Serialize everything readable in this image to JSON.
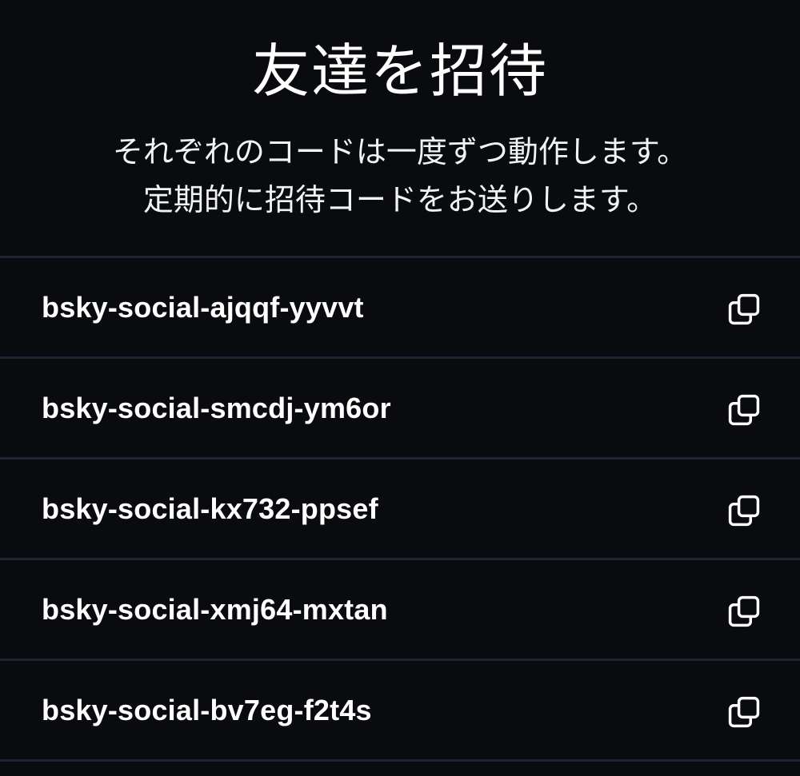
{
  "header": {
    "title": "友達を招待",
    "description_line1": "それぞれのコードは一度ずつ動作します。",
    "description_line2": "定期的に招待コードをお送りします。"
  },
  "codes": [
    {
      "code": "bsky-social-ajqqf-yyvvt",
      "icon": "copy-icon"
    },
    {
      "code": "bsky-social-smcdj-ym6or",
      "icon": "copy-icon"
    },
    {
      "code": "bsky-social-kx732-ppsef",
      "icon": "copy-icon"
    },
    {
      "code": "bsky-social-xmj64-mxtan",
      "icon": "copy-icon"
    },
    {
      "code": "bsky-social-bv7eg-f2t4s",
      "icon": "copy-icon"
    }
  ],
  "colors": {
    "background": "#0a0b0e",
    "divider": "#1e2530",
    "text": "#ffffff"
  }
}
